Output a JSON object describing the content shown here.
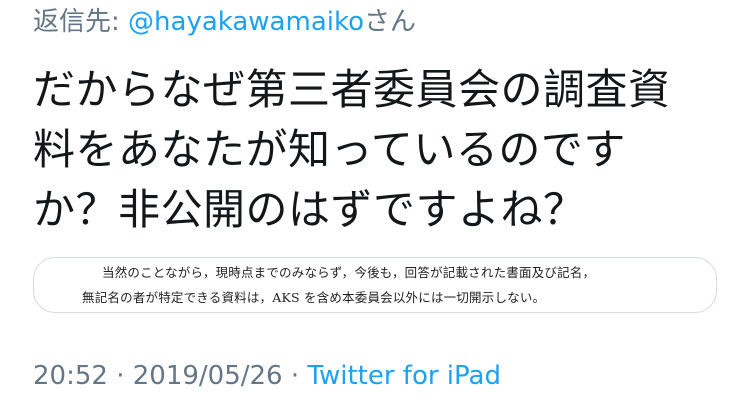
{
  "reply": {
    "prefix": "返信先: ",
    "handle": "@hayakawamaiko",
    "suffix": "さん"
  },
  "tweet": {
    "lines": [
      "だからなぜ第三者委員会の調査資",
      "料をあなたが知っているのです",
      "か？非公開のはずですよね？"
    ]
  },
  "media": {
    "doc_lines": [
      "当然のことながら，現時点までのみならず，今後も，回答が記載された書面及び記名，",
      "無記名の者が特定できる資料は，AKS を含め本委員会以外には一切開示しない。"
    ]
  },
  "meta": {
    "time": "20:52",
    "separator": " · ",
    "date": "2019/05/26",
    "separator2": " · ",
    "source": "Twitter for iPad"
  },
  "colors": {
    "text": "#14171a",
    "secondary": "#657786",
    "link": "#1da1f2",
    "border": "#d4dbe1"
  }
}
